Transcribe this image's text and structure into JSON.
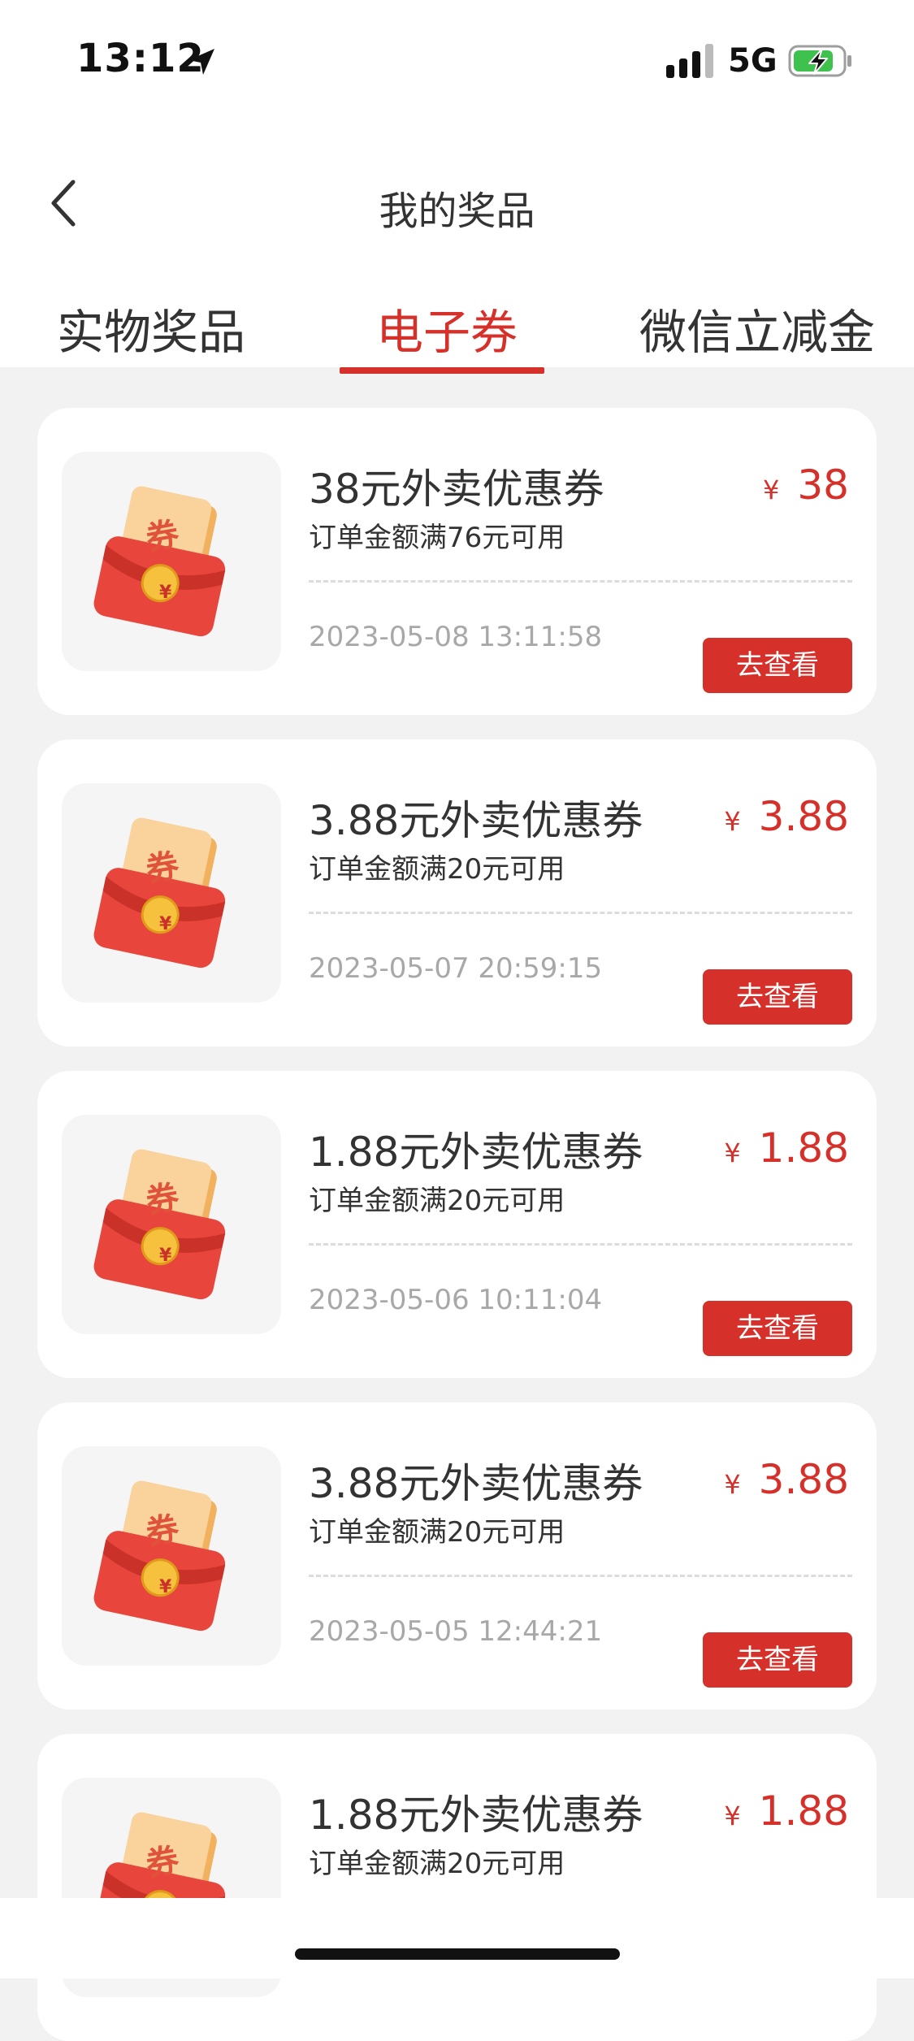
{
  "status_bar": {
    "time": "13:12",
    "network": "5G",
    "icons": [
      "location-arrow-icon",
      "signal-icon",
      "battery-charging-icon"
    ]
  },
  "nav": {
    "title": "我的奖品",
    "back_icon": "chevron-left-icon"
  },
  "tabs": [
    {
      "label": "实物奖品",
      "active": false
    },
    {
      "label": "电子券",
      "active": true
    },
    {
      "label": "微信立减金",
      "active": false
    }
  ],
  "coupon_icon": {
    "badge_text": "券",
    "coin_symbol": "¥"
  },
  "coupons": [
    {
      "title": "38元外卖优惠券",
      "condition": "订单金额满76元可用",
      "currency": "¥",
      "amount": "38",
      "date": "2023-05-08 13:11:58",
      "button": "去查看"
    },
    {
      "title": "3.88元外卖优惠券",
      "condition": "订单金额满20元可用",
      "currency": "¥",
      "amount": "3.88",
      "date": "2023-05-07 20:59:15",
      "button": "去查看"
    },
    {
      "title": "1.88元外卖优惠券",
      "condition": "订单金额满20元可用",
      "currency": "¥",
      "amount": "1.88",
      "date": "2023-05-06 10:11:04",
      "button": "去查看"
    },
    {
      "title": "3.88元外卖优惠券",
      "condition": "订单金额满20元可用",
      "currency": "¥",
      "amount": "3.88",
      "date": "2023-05-05 12:44:21",
      "button": "去查看"
    },
    {
      "title": "1.88元外卖优惠券",
      "condition": "订单金额满20元可用",
      "currency": "¥",
      "amount": "1.88",
      "date": "",
      "button": ""
    }
  ],
  "colors": {
    "accent": "#d5312a",
    "background": "#f2f2f2",
    "card": "#ffffff",
    "muted_text": "#a8a8a8"
  }
}
